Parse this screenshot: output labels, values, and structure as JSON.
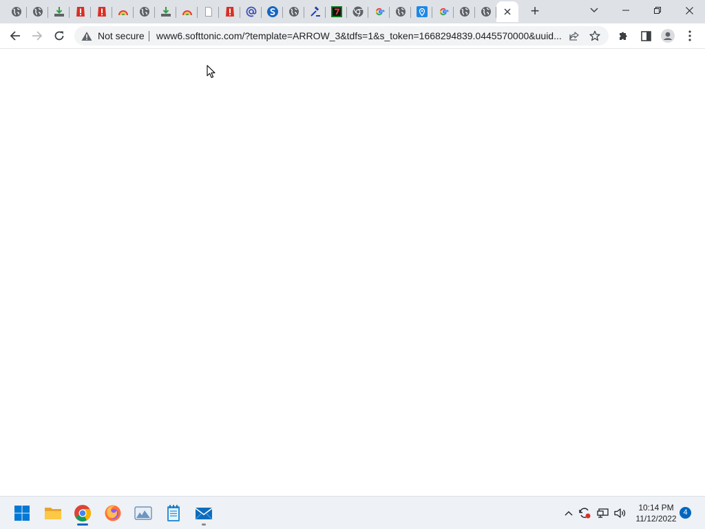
{
  "browser": {
    "tabs": [
      {
        "icon": "globe-icon"
      },
      {
        "icon": "globe-icon"
      },
      {
        "icon": "download-icon"
      },
      {
        "icon": "alert-shield-icon"
      },
      {
        "icon": "alert-shield-icon"
      },
      {
        "icon": "rainbow-icon"
      },
      {
        "icon": "globe-icon"
      },
      {
        "icon": "download-icon"
      },
      {
        "icon": "rainbow-icon"
      },
      {
        "icon": "blank-page-icon"
      },
      {
        "icon": "alert-shield-icon"
      },
      {
        "icon": "at-sign-icon"
      },
      {
        "icon": "s-logo-icon"
      },
      {
        "icon": "globe-icon"
      },
      {
        "icon": "gavel-icon"
      },
      {
        "icon": "seven-logo-icon"
      },
      {
        "icon": "chrome-icon"
      },
      {
        "icon": "google-icon"
      },
      {
        "icon": "globe-icon"
      },
      {
        "icon": "location-pin-icon"
      },
      {
        "icon": "google-icon"
      },
      {
        "icon": "globe-icon"
      },
      {
        "icon": "globe-icon"
      },
      {
        "icon": "close-icon",
        "active": true
      }
    ],
    "new_tab_symbol": "+",
    "address_bar": {
      "security_label": "Not secure",
      "url": "www6.softtonic.com/?template=ARROW_3&tdfs=1&s_token=1668294839.0445570000&uuid..."
    }
  },
  "taskbar": {
    "apps": [
      {
        "name": "start-button",
        "icon": "windows-logo-icon"
      },
      {
        "name": "file-explorer",
        "icon": "folder-icon"
      },
      {
        "name": "chrome",
        "icon": "chrome-icon",
        "running": "active"
      },
      {
        "name": "firefox",
        "icon": "firefox-icon"
      },
      {
        "name": "photos",
        "icon": "photos-icon"
      },
      {
        "name": "notepad",
        "icon": "notepad-icon"
      },
      {
        "name": "mail",
        "icon": "mail-icon",
        "running": "open"
      }
    ],
    "clock": {
      "time": "10:14 PM",
      "date": "11/12/2022"
    },
    "notification_count": "4"
  },
  "colors": {
    "tabstrip_bg": "#dee1e6",
    "accent": "#0067c0",
    "alert_red": "#d93025"
  }
}
